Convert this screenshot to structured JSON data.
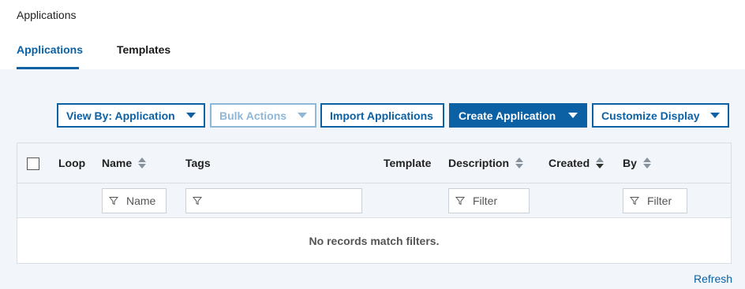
{
  "breadcrumb": "Applications",
  "tabs": [
    {
      "label": "Applications",
      "active": true
    },
    {
      "label": "Templates",
      "active": false
    }
  ],
  "toolbar": {
    "view_by": "View By: Application",
    "bulk_actions": "Bulk Actions",
    "import": "Import Applications",
    "create": "Create Application",
    "customize": "Customize Display"
  },
  "table": {
    "columns": {
      "loop": "Loop",
      "name": "Name",
      "tags": "Tags",
      "template": "Template",
      "description": "Description",
      "created": "Created",
      "by": "By"
    },
    "filters": {
      "name_placeholder": "Name",
      "tags_placeholder": "",
      "description_placeholder": "Filter",
      "by_placeholder": "Filter"
    },
    "empty_message": "No records match filters."
  },
  "refresh_label": "Refresh",
  "colors": {
    "accent": "#0b61a4",
    "disabled": "#8fb7d8",
    "panel": "#f2f5f9"
  }
}
